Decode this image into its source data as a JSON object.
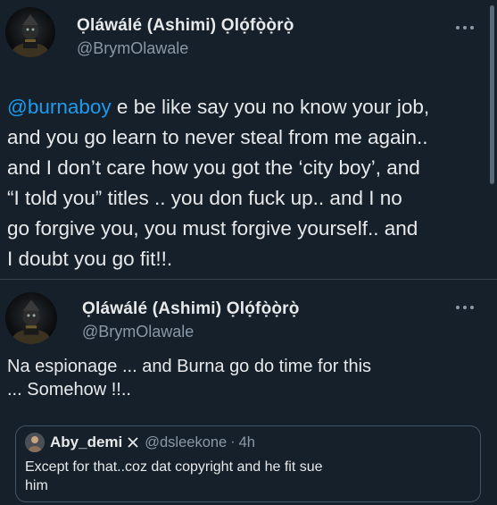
{
  "tweets": [
    {
      "author": {
        "display_name": "Ọláwálé (Ashimi) Ọlọ́fọ̀ọ̀rọ̀",
        "handle": "@BrymOlawale",
        "avatar_icon": "masked-figure-avatar"
      },
      "mention": "@burnaboy",
      "text": " e be like say you no know your job,\nand you go learn to never steal from me again..\nand I don’t care how you got the ‘city boy’, and\n“I told you” titles .. you don fuck up.. and I no\ngo forgive you, you must forgive yourself.. and\nI doubt you go fit!!.",
      "more_icon": "more-options-icon"
    },
    {
      "author": {
        "display_name": "Ọláwálé (Ashimi) Ọlọ́fọ̀ọ̀rọ̀",
        "handle": "@BrymOlawale",
        "avatar_icon": "masked-figure-avatar"
      },
      "text": "Na espionage ... and Burna go do time for this\n... Somehow !!..",
      "more_icon": "more-options-icon",
      "quote": {
        "name": "Aby_demi",
        "verified_icon": "x-icon",
        "handle": "@dsleekone",
        "dot": "·",
        "time": "4h",
        "text": "Except for that..coz dat copyright and he fit sue\nhim"
      }
    }
  ],
  "colors": {
    "background": "#15202b",
    "text": "#e7e9ea",
    "secondary": "#8b98a5",
    "link": "#1d9bf0"
  }
}
